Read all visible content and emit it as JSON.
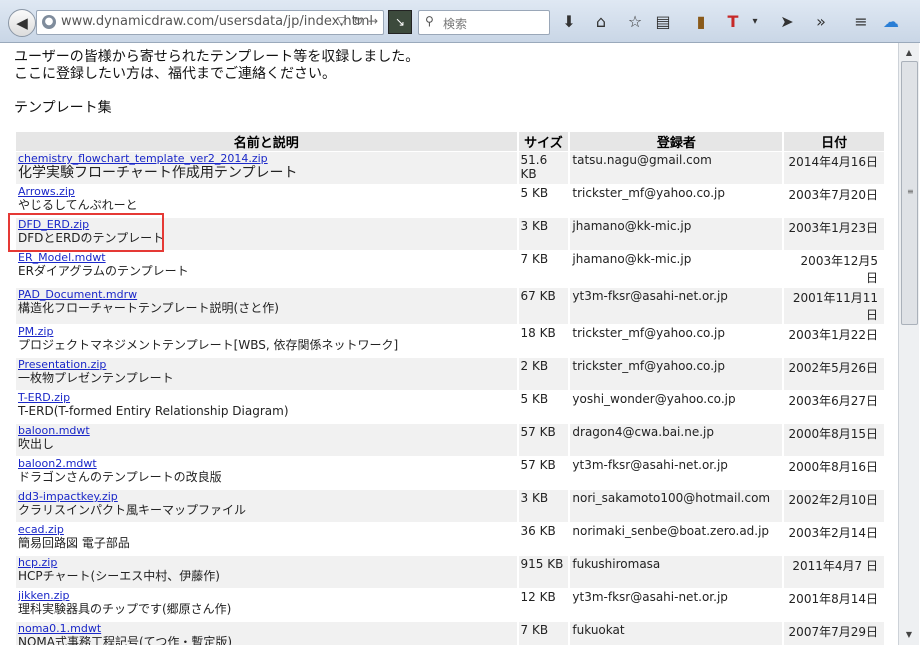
{
  "browser": {
    "url": "www.dynamicdraw.com/usersdata/jp/index.html",
    "search_placeholder": "検索"
  },
  "page": {
    "intro_line1": "ユーザーの皆様から寄せられたテンプレート等を収録しました。",
    "intro_line2": "ここに登録したい方は、福代までご連絡ください。",
    "section_title": "テンプレート集",
    "table_headers": {
      "name": "名前と説明",
      "size": "サイズ",
      "registrant": "登録者",
      "date": "日付"
    },
    "rows": [
      {
        "file": "chemistry_flowchart_template_ver2_2014.zip",
        "desc": "化学実験フローチャート作成用テンプレート",
        "size": "51.6 KB",
        "email": "tatsu.nagu@gmail.com",
        "date": "2014年4月16日"
      },
      {
        "file": "Arrows.zip",
        "desc": "やじるしてんぷれーと",
        "size": "5 KB",
        "email": "trickster_mf@yahoo.co.jp",
        "date": "2003年7月20日"
      },
      {
        "file": "DFD_ERD.zip",
        "desc": "DFDとERDのテンプレート",
        "size": "3 KB",
        "email": "jhamano@kk-mic.jp",
        "date": "2003年1月23日"
      },
      {
        "file": "ER_Model.mdwt",
        "desc": "ERダイアグラムのテンプレート",
        "size": "7 KB",
        "email": "jhamano@kk-mic.jp",
        "date": "2003年12月5 日"
      },
      {
        "file": "PAD_Document.mdrw",
        "desc": "構造化フローチャートテンプレート説明(さと作)",
        "size": "67 KB",
        "email": "yt3m-fksr@asahi-net.or.jp",
        "date": "2001年11月11日"
      },
      {
        "file": "PM.zip",
        "desc": "プロジェクトマネジメントテンプレート[WBS, 依存関係ネットワーク]",
        "size": "18 KB",
        "email": "trickster_mf@yahoo.co.jp",
        "date": "2003年1月22日"
      },
      {
        "file": "Presentation.zip",
        "desc": "一枚物プレゼンテンプレート",
        "size": "2 KB",
        "email": "trickster_mf@yahoo.co.jp",
        "date": "2002年5月26日"
      },
      {
        "file": "T-ERD.zip",
        "desc": "T-ERD(T-formed Entiry Relationship Diagram)",
        "size": "5 KB",
        "email": "yoshi_wonder@yahoo.co.jp",
        "date": "2003年6月27日"
      },
      {
        "file": "baloon.mdwt",
        "desc": "吹出し",
        "size": "57 KB",
        "email": "dragon4@cwa.bai.ne.jp",
        "date": "2000年8月15日"
      },
      {
        "file": "baloon2.mdwt",
        "desc": "ドラゴンさんのテンプレートの改良版",
        "size": "57 KB",
        "email": "yt3m-fksr@asahi-net.or.jp",
        "date": "2000年8月16日"
      },
      {
        "file": "dd3-impactkey.zip",
        "desc": "クラリスインパクト風キーマップファイル",
        "size": "3 KB",
        "email": "nori_sakamoto100@hotmail.com",
        "date": "2002年2月10日"
      },
      {
        "file": "ecad.zip",
        "desc": "簡易回路図 電子部品",
        "size": "36 KB",
        "email": "norimaki_senbe@boat.zero.ad.jp",
        "date": "2003年2月14日"
      },
      {
        "file": "hcp.zip",
        "desc": "HCPチャート(シーエス中村、伊藤作)",
        "size": "915 KB",
        "email": "fukushiromasa",
        "date": "2011年4月7 日"
      },
      {
        "file": "jikken.zip",
        "desc": "理科実験器具のチップです(郷原さん作)",
        "size": "12 KB",
        "email": "yt3m-fksr@asahi-net.or.jp",
        "date": "2001年8月14日"
      },
      {
        "file": "noma0.1.mdwt",
        "desc": "NOMA式事務工程記号(てつ作・暫定版)",
        "size": "7 KB",
        "email": "fukuokat",
        "date": "2007年7月29日"
      }
    ]
  }
}
